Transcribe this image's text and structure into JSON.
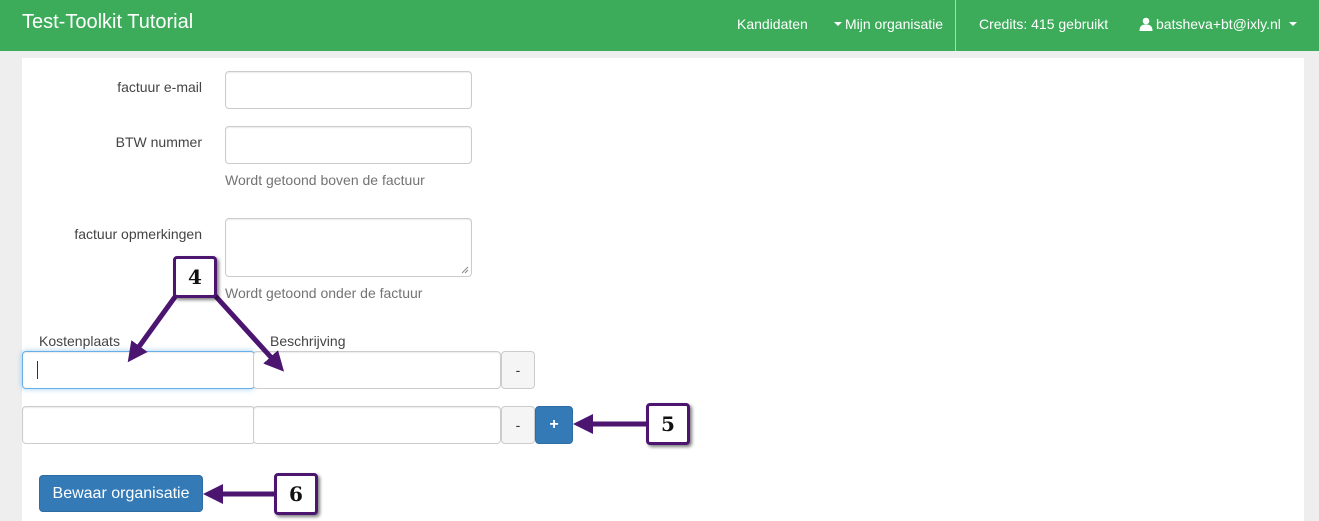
{
  "navbar": {
    "brand": "Test-Toolkit Tutorial",
    "kandidaten": "Kandidaten",
    "mijn_organisatie": "Mijn organisatie",
    "credits": "Credits: 415 gebruikt",
    "user": "batsheva+bt@ixly.nl"
  },
  "form": {
    "factuur_email_label": "factuur e-mail",
    "btw_label": "BTW nummer",
    "btw_help": "Wordt getoond boven de factuur",
    "opmerkingen_label": "factuur opmerkingen",
    "opmerkingen_help": "Wordt getoond onder de factuur",
    "kostenplaats_label": "Kostenplaats",
    "beschrijving_label": "Beschrijving",
    "remove_label": "-",
    "add_label": "+",
    "save_label": "Bewaar organisatie"
  },
  "callouts": {
    "c4": "4",
    "c5": "5",
    "c6": "6"
  },
  "colors": {
    "navbar": "#3cac5a",
    "primary": "#337ab7",
    "callout_border": "#4b1570"
  }
}
